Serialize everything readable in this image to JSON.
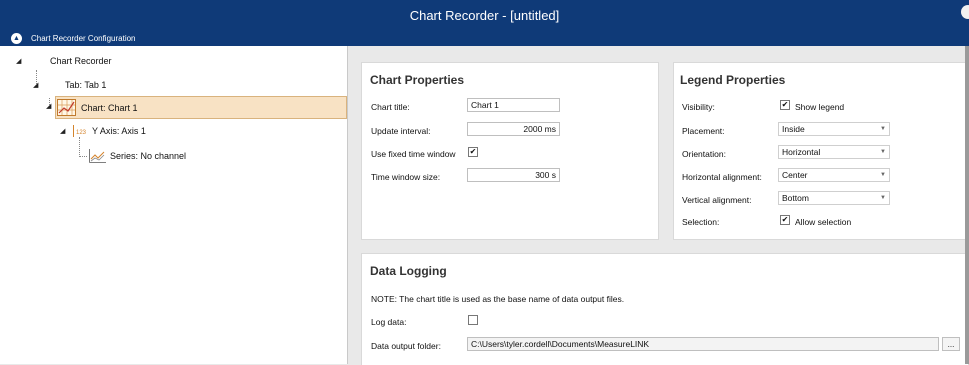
{
  "window": {
    "title": "Chart Recorder - [untitled]"
  },
  "config_bar": {
    "label": "Chart Recorder Configuration",
    "collapse_glyph": "▲"
  },
  "tree": {
    "root": "Chart Recorder",
    "tab": "Tab: Tab 1",
    "chart": "Chart:  Chart 1",
    "axis": "Y Axis:  Axis 1",
    "series": "Series:  No channel",
    "axis_icon_text": "123"
  },
  "chart_properties": {
    "title": "Chart Properties",
    "chart_title_label": "Chart title:",
    "chart_title_value": "Chart 1",
    "update_interval_label": "Update interval:",
    "update_interval_value": "2000 ms",
    "fixed_window_label": "Use fixed time window",
    "fixed_window_checked": true,
    "window_size_label": "Time window size:",
    "window_size_value": "300 s"
  },
  "legend_properties": {
    "title": "Legend Properties",
    "visibility_label": "Visibility:",
    "visibility_option": "Show legend",
    "visibility_checked": true,
    "placement_label": "Placement:",
    "placement_value": "Inside",
    "orientation_label": "Orientation:",
    "orientation_value": "Horizontal",
    "h_align_label": "Horizontal alignment:",
    "h_align_value": "Center",
    "v_align_label": "Vertical alignment:",
    "v_align_value": "Bottom",
    "selection_label": "Selection:",
    "selection_option": "Allow selection",
    "selection_checked": true
  },
  "data_logging": {
    "title": "Data Logging",
    "note": "NOTE: The chart title is used as the base name of data output files.",
    "log_label": "Log data:",
    "log_checked": false,
    "folder_label": "Data output folder:",
    "folder_value": "C:\\Users\\tyler.cordell\\Documents\\MeasureLINK",
    "browse_label": "..."
  },
  "icons": {
    "checkmark": "✔",
    "tree_expanded": "◢",
    "dropdown": "▼"
  },
  "colors": {
    "title_bar": "#0f3a78",
    "selection_fill": "#f8e2c4",
    "selection_border": "#d9b37e",
    "workspace_bg": "#e9e9e9"
  }
}
